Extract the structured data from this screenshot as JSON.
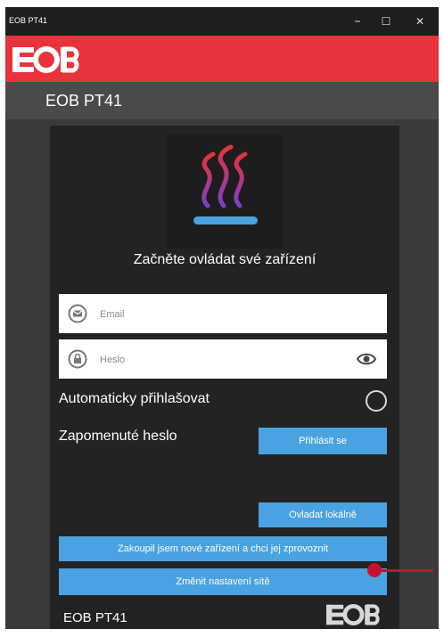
{
  "window": {
    "title": "EOB PT41",
    "minimize": "–",
    "maximize": "☐",
    "close": "✕"
  },
  "brand": {
    "logo_text": "EOB",
    "color": "#e8323c"
  },
  "header": {
    "title": "EOB PT41"
  },
  "login": {
    "headline": "Začněte ovládat své zařízení",
    "email": {
      "placeholder": "Email",
      "icon": "mail-icon"
    },
    "password": {
      "placeholder": "Heslo",
      "icon": "lock-icon",
      "toggle_icon": "eye-icon"
    },
    "auto_login_label": "Automaticky přihlašovat",
    "forgot_password": "Zapomenuté heslo",
    "login_button": "Přihlásit se",
    "local_button": "Ovladat lokálně",
    "new_device_button": "Zakoupil jsem nové zařízení a chci jej zprovoznit",
    "network_button": "Změnit nastavení sítě"
  },
  "footer": {
    "title": "EOB PT41",
    "logo_text": "EOB"
  },
  "colors": {
    "accent": "#4aa3e0",
    "marker": "#c8102e",
    "panel": "#232323"
  }
}
